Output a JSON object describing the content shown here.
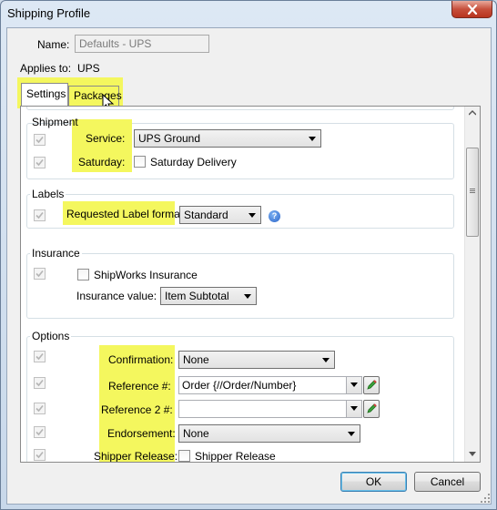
{
  "window": {
    "title": "Shipping Profile"
  },
  "header": {
    "name_label": "Name:",
    "name_value": "Defaults - UPS",
    "applies_label": "Applies to:",
    "applies_value": "UPS"
  },
  "tabs": [
    {
      "label": "Settings",
      "selected": true
    },
    {
      "label": "Packages",
      "selected": false
    }
  ],
  "shipment": {
    "group_label": "Shipment",
    "service_label": "Service:",
    "service_value": "UPS Ground",
    "saturday_label": "Saturday:",
    "saturday_check_label": "Saturday Delivery"
  },
  "labels": {
    "group_label": "Labels",
    "format_label": "Requested Label format:",
    "format_value": "Standard"
  },
  "insurance": {
    "group_label": "Insurance",
    "check_label": "ShipWorks Insurance",
    "value_label": "Insurance value:",
    "value_value": "Item Subtotal"
  },
  "options": {
    "group_label": "Options",
    "confirmation_label": "Confirmation:",
    "confirmation_value": "None",
    "reference_label": "Reference #:",
    "reference_value": "Order {//Order/Number}",
    "reference2_label": "Reference 2 #:",
    "reference2_value": "",
    "endorsement_label": "Endorsement:",
    "endorsement_value": "None",
    "shipper_release_label": "Shipper Release:",
    "shipper_release_check_label": "Shipper Release"
  },
  "buttons": {
    "ok": "OK",
    "cancel": "Cancel"
  },
  "colors": {
    "highlight": "#f4f75e",
    "title_bar": "#c8d8ea",
    "close_button": "#c7503c"
  }
}
